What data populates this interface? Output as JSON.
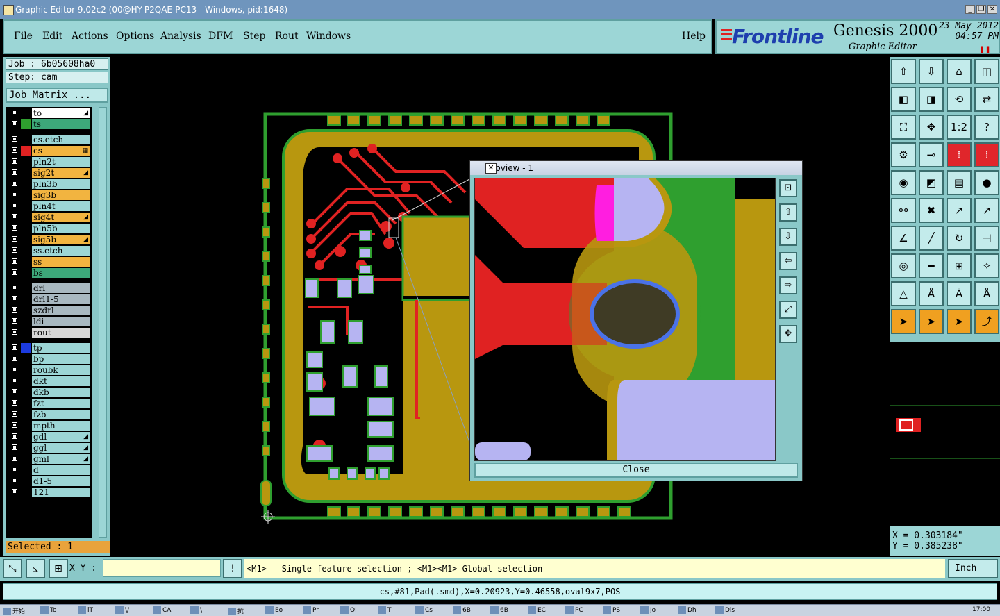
{
  "window": {
    "title": "Graphic Editor 9.02c2 (00@HY-P2QAE-PC13 - Windows, pid:1648)",
    "controls": [
      "_",
      "❐",
      "✕"
    ]
  },
  "menu": {
    "items": [
      "File",
      "Edit",
      "Actions",
      "Options",
      "Analysis",
      "DFM",
      "Step",
      "Rout",
      "Windows"
    ],
    "help": "Help"
  },
  "brand": {
    "logo": "Frontline",
    "product": "Genesis 2000",
    "subtitle": "Graphic Editor",
    "date": "23 May 2012",
    "time": "04:57 PM",
    "pause": "❚❚"
  },
  "job": {
    "job_line": "Job : 6b05608ha0",
    "step_line": "Step: cam",
    "matrix_button": "Job Matrix ..."
  },
  "layers": [
    {
      "name": "to",
      "bg": "#ffffff",
      "sw": "#000000",
      "mark": "◢"
    },
    {
      "name": "ts",
      "bg": "#3da87a",
      "sw": "#2f9f2f",
      "mark": ""
    },
    {
      "name": "cs.etch",
      "bg": "#9cd6d6",
      "sw": "#000000",
      "mark": ""
    },
    {
      "name": "cs",
      "bg": "#f2b440",
      "sw": "#e02222",
      "mark": "▦"
    },
    {
      "name": "pln2t",
      "bg": "#9cd6d6",
      "sw": "#000000",
      "mark": ""
    },
    {
      "name": "sig2t",
      "bg": "#f2b440",
      "sw": "#000000",
      "mark": "◢"
    },
    {
      "name": "pln3b",
      "bg": "#9cd6d6",
      "sw": "#000000",
      "mark": ""
    },
    {
      "name": "sig3b",
      "bg": "#f2b440",
      "sw": "#000000",
      "mark": ""
    },
    {
      "name": "pln4t",
      "bg": "#9cd6d6",
      "sw": "#000000",
      "mark": ""
    },
    {
      "name": "sig4t",
      "bg": "#f2b440",
      "sw": "#000000",
      "mark": "◢"
    },
    {
      "name": "pln5b",
      "bg": "#9cd6d6",
      "sw": "#000000",
      "mark": ""
    },
    {
      "name": "sig5b",
      "bg": "#f2b440",
      "sw": "#000000",
      "mark": "◢"
    },
    {
      "name": "ss.etch",
      "bg": "#9cd6d6",
      "sw": "#000000",
      "mark": ""
    },
    {
      "name": "ss",
      "bg": "#f2b440",
      "sw": "#000000",
      "mark": ""
    },
    {
      "name": "bs",
      "bg": "#3da87a",
      "sw": "#000000",
      "mark": ""
    },
    {
      "name": "drl",
      "bg": "#a8b8c0",
      "sw": "#000000",
      "mark": ""
    },
    {
      "name": "drl1-5",
      "bg": "#a8b8c0",
      "sw": "#000000",
      "mark": ""
    },
    {
      "name": "szdrl",
      "bg": "#a8b8c0",
      "sw": "#000000",
      "mark": ""
    },
    {
      "name": "ldi",
      "bg": "#a8b8c0",
      "sw": "#000000",
      "mark": ""
    },
    {
      "name": "rout",
      "bg": "#d8d8d8",
      "sw": "#000000",
      "mark": ""
    },
    {
      "name": "tp",
      "bg": "#9cd6d6",
      "sw": "#1c3be0",
      "mark": ""
    },
    {
      "name": "bp",
      "bg": "#9cd6d6",
      "sw": "#000000",
      "mark": ""
    },
    {
      "name": "roubk",
      "bg": "#9cd6d6",
      "sw": "#000000",
      "mark": ""
    },
    {
      "name": "dkt",
      "bg": "#9cd6d6",
      "sw": "#000000",
      "mark": ""
    },
    {
      "name": "dkb",
      "bg": "#9cd6d6",
      "sw": "#000000",
      "mark": ""
    },
    {
      "name": "fzt",
      "bg": "#9cd6d6",
      "sw": "#000000",
      "mark": ""
    },
    {
      "name": "fzb",
      "bg": "#9cd6d6",
      "sw": "#000000",
      "mark": ""
    },
    {
      "name": "mpth",
      "bg": "#9cd6d6",
      "sw": "#000000",
      "mark": ""
    },
    {
      "name": "gdl",
      "bg": "#9cd6d6",
      "sw": "#000000",
      "mark": "◢"
    },
    {
      "name": "ggl",
      "bg": "#9cd6d6",
      "sw": "#000000",
      "mark": "◢"
    },
    {
      "name": "gml",
      "bg": "#9cd6d6",
      "sw": "#000000",
      "mark": "◢"
    },
    {
      "name": "d",
      "bg": "#9cd6d6",
      "sw": "#000000",
      "mark": ""
    },
    {
      "name": "d1-5",
      "bg": "#9cd6d6",
      "sw": "#000000",
      "mark": ""
    },
    {
      "name": "121",
      "bg": "#9cd6d6",
      "sw": "#000000",
      "mark": ""
    }
  ],
  "selected": "Selected : 1",
  "popview": {
    "title": "Popview - 1",
    "close_label": "Close",
    "tools": [
      "⊡",
      "⇧",
      "⇩",
      "⇦",
      "⇨",
      "⤢",
      "✥"
    ]
  },
  "toolbox": [
    [
      "⇧",
      "⇩",
      "⌂",
      "◫"
    ],
    [
      "◧",
      "◨",
      "⟲",
      "⇄"
    ],
    [
      "⛶",
      "✥",
      "1:2",
      "?"
    ],
    [
      "⚙",
      "⊸",
      "⁞",
      "⁞"
    ],
    [
      "◉",
      "◩",
      "▤",
      "●"
    ],
    [
      "⚯",
      "✖",
      "↗",
      "↗"
    ],
    [
      "∠",
      "╱",
      "↻",
      "⊣"
    ],
    [
      "◎",
      "━",
      "⊞",
      "✧"
    ],
    [
      "△",
      "Å",
      "Å",
      "Å"
    ],
    [
      "➤",
      "➤",
      "➤",
      "⤴"
    ]
  ],
  "coords": {
    "x": "X = 0.303184\"",
    "y": "Y = 0.385238\""
  },
  "status": {
    "xy_label": "X Y :",
    "xy_value": "",
    "message": "<M1> - Single feature selection ; <M1><M1> Global selection",
    "unit": "Inch",
    "alert": "!"
  },
  "info": "cs,#81,Pad(.smd),X=0.20923,Y=0.46558,oval9x7,POS",
  "taskbar": [
    "开始",
    "To",
    "iT",
    "\\/",
    "CA",
    "\\",
    "抗",
    "Eo",
    "Pr",
    "Ol",
    "T",
    "Cs",
    "6B",
    "6B",
    "EC",
    "PC",
    "PS",
    "Jo",
    "Dh",
    "Dis"
  ],
  "clock": "17:00",
  "colors": {
    "panel": "#8ac8c8",
    "copper": "#b8970f",
    "signal": "#e02222",
    "solder": "#2f9f2f",
    "pad": "#b6b4f2"
  }
}
